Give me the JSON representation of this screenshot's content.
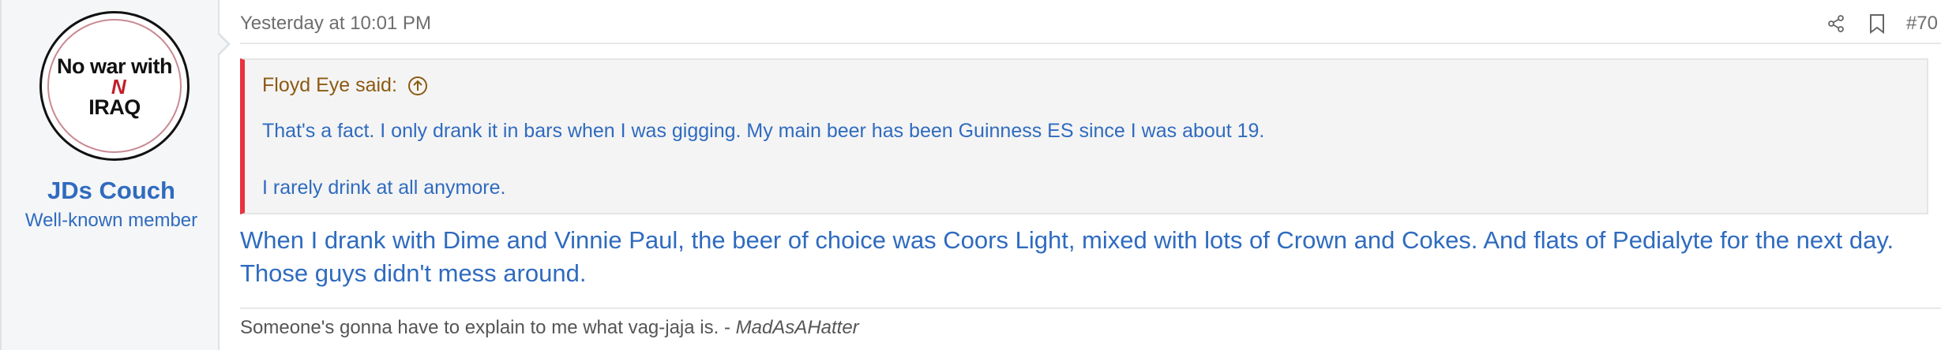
{
  "user": {
    "avatar_text_line1": "No war with",
    "avatar_text_n": "N",
    "avatar_text_line2": "IRAQ",
    "name": "JDs Couch",
    "title": "Well-known member"
  },
  "post": {
    "timestamp": "Yesterday at 10:01 PM",
    "number": "#70",
    "icons": [
      "share-icon",
      "bookmark-icon"
    ]
  },
  "quote": {
    "author_said": "Floyd Eye said:",
    "line1": "That's a fact. I only drank it in bars when I was gigging. My main beer has been Guinness ES since I was about 19.",
    "line2": "I rarely drink at all anymore."
  },
  "message": {
    "text": "When I drank with Dime and Vinnie Paul, the beer of choice was Coors Light, mixed with lots of Crown and Cokes. And flats of Pedialyte for the next day. Those guys didn't mess around."
  },
  "signature": {
    "text": "Someone's gonna have to explain to me what vag-jaja is. - ",
    "author": "MadAsAHatter"
  },
  "colors": {
    "link_blue": "#2f6bbf",
    "quote_author_brown": "#8c5a12",
    "quote_bar_red": "#e8323e"
  }
}
